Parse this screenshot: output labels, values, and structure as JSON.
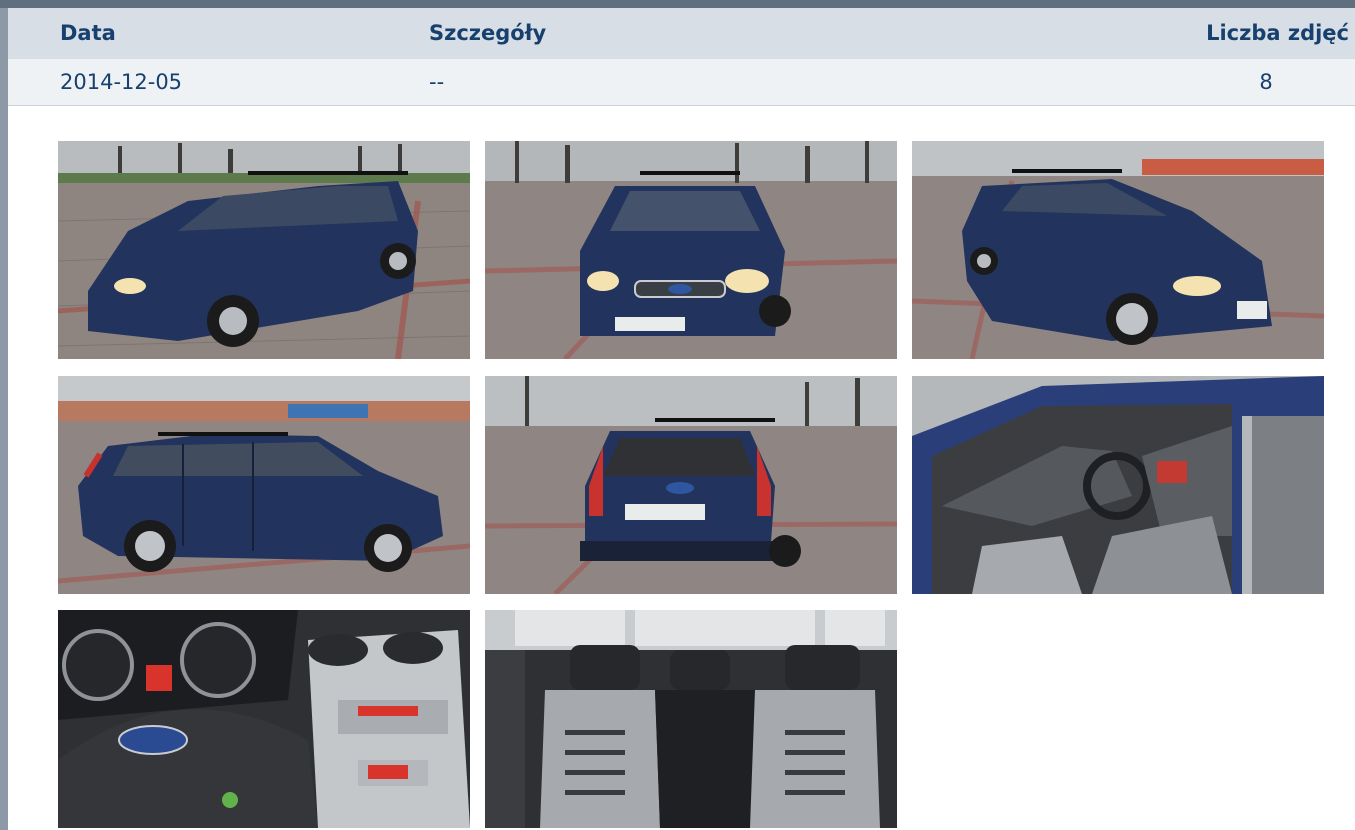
{
  "table": {
    "headers": {
      "date": "Data",
      "details": "Szczegóły",
      "photo_count": "Liczba zdjęć"
    },
    "row": {
      "date": "2014-12-05",
      "details": "--",
      "photo_count": "8"
    }
  },
  "photos": [
    {
      "subject": "car-front-left-photo"
    },
    {
      "subject": "car-front-photo"
    },
    {
      "subject": "car-front-right-photo"
    },
    {
      "subject": "car-side-photo"
    },
    {
      "subject": "car-rear-photo"
    },
    {
      "subject": "car-interior-front-photo"
    },
    {
      "subject": "car-dashboard-photo"
    },
    {
      "subject": "car-rear-seats-photo"
    }
  ],
  "colors": {
    "accent_text": "#17406e",
    "header_bg": "#d7dee5",
    "row_bg": "#eef2f5",
    "top_bar": "#5f6f7e",
    "car_body": "#22345e"
  }
}
